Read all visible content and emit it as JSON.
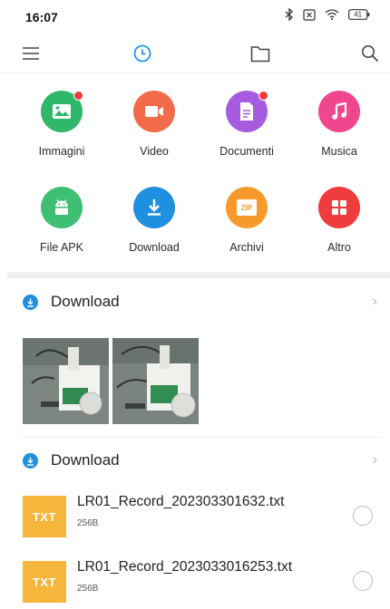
{
  "status_bar": {
    "time": "16:07",
    "battery": "41"
  },
  "toolbar": {
    "menu_icon": "hamburger-menu-icon",
    "recent_icon": "clock-icon",
    "folder_icon": "folder-icon",
    "search_icon": "search-icon",
    "accent": "#2196f3"
  },
  "categories": [
    {
      "label": "Immagini",
      "color": "#2fb86a",
      "icon": "image-icon",
      "badge": true
    },
    {
      "label": "Video",
      "color": "#f26b4a",
      "icon": "video-camera-icon",
      "badge": false
    },
    {
      "label": "Documenti",
      "color": "#a75ce0",
      "icon": "document-icon",
      "badge": true
    },
    {
      "label": "Musica",
      "color": "#f0468e",
      "icon": "music-note-icon",
      "badge": false
    },
    {
      "label": "File APK",
      "color": "#3fbf73",
      "icon": "android-icon",
      "badge": false
    },
    {
      "label": "Download",
      "color": "#1f8fe0",
      "icon": "download-icon",
      "badge": false
    },
    {
      "label": "Archivi",
      "color": "#f79a2b",
      "icon": "zip-icon",
      "icon_text": "ZIP",
      "badge": false
    },
    {
      "label": "Altro",
      "color": "#ef3d3d",
      "icon": "grid-icon",
      "badge": false
    }
  ],
  "sections": [
    {
      "title": "Download",
      "chevron": "›"
    },
    {
      "title": "Download",
      "chevron": "›"
    }
  ],
  "files": [
    {
      "name": "LR01_Record_202303301632.txt",
      "size": "256B",
      "type": "TXT"
    },
    {
      "name": "LR01_Record_2023033016253.txt",
      "size": "256B",
      "type": "TXT"
    }
  ]
}
